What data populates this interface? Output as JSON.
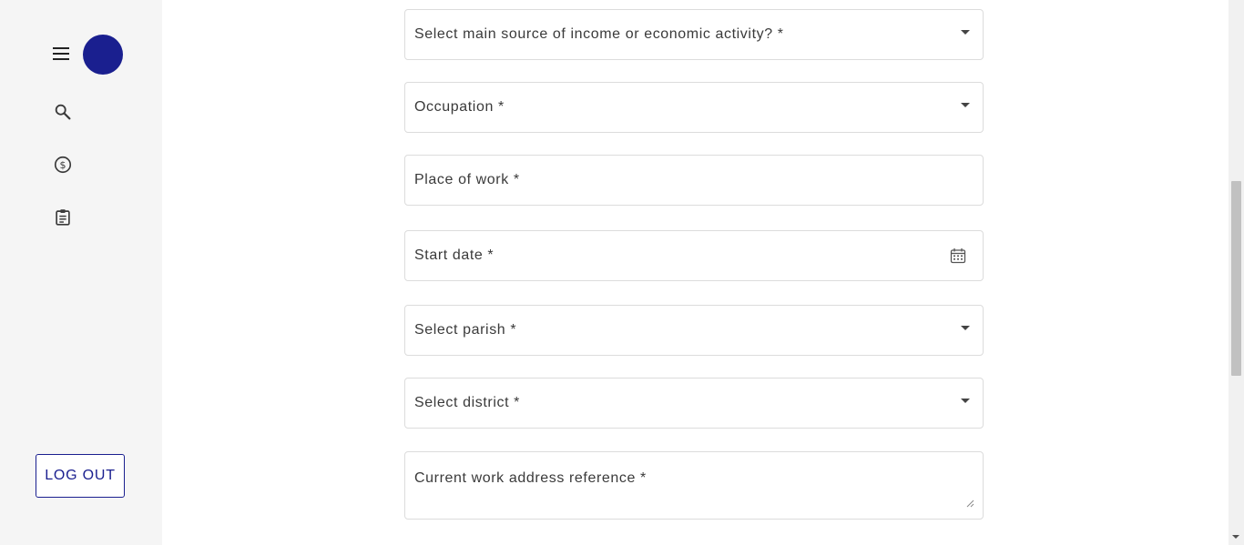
{
  "sidebar": {
    "menu_icon": "menu-icon",
    "avatar_color": "#1a1f8f",
    "nav_icons": [
      "search-icon",
      "dollar-circle-icon",
      "clipboard-icon"
    ],
    "logout_label": "LOG OUT"
  },
  "form": {
    "income_source": {
      "label": "Select main source of income or economic activity? *",
      "icon": "caret-down-icon"
    },
    "occupation": {
      "label": "Occupation *",
      "icon": "caret-down-icon"
    },
    "place_of_work": {
      "label": "Place of work *"
    },
    "start_date": {
      "label": "Start date *",
      "icon": "calendar-icon"
    },
    "parish": {
      "label": "Select parish *",
      "icon": "caret-down-icon"
    },
    "district": {
      "label": "Select district *",
      "icon": "caret-down-icon"
    },
    "work_address": {
      "label": "Current work address reference *"
    }
  },
  "colors": {
    "accent": "#1a1f8f",
    "sidebar_bg": "#f5f5f5",
    "field_border": "#dcdcdc"
  }
}
